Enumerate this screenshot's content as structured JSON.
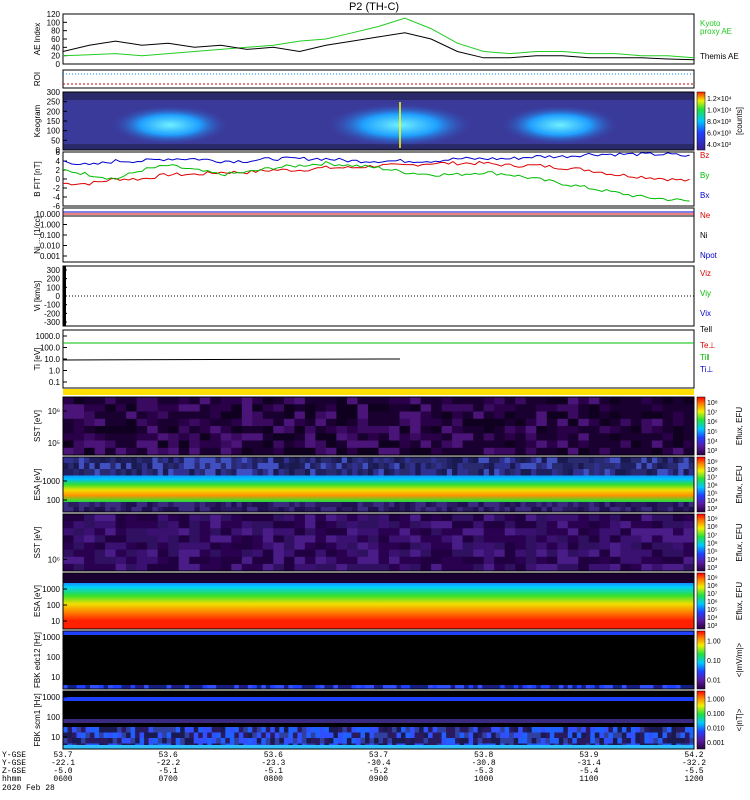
{
  "title": "P2 (TH-C)",
  "date_label": "2020 Feb 28",
  "footer": {
    "row_labels": [
      "Y-GSE",
      "Y-GSE",
      "Z-GSE",
      "hhmm"
    ],
    "columns": [
      {
        "v": [
          "53.7",
          "-22.1",
          "-5.0",
          "0600"
        ]
      },
      {
        "v": [
          "53.6",
          "-22.2",
          "-5.1",
          "0700"
        ]
      },
      {
        "v": [
          "53.6",
          "-23.3",
          "-5.1",
          "0800"
        ]
      },
      {
        "v": [
          "53.7",
          "-30.4",
          "-5.2",
          "0900"
        ]
      },
      {
        "v": [
          "53.8",
          "-30.8",
          "-5.3",
          "1000"
        ]
      },
      {
        "v": [
          "53.9",
          "-31.4",
          "-5.4",
          "1100"
        ]
      },
      {
        "v": [
          "54.2",
          "-32.2",
          "-5.5",
          "1200"
        ]
      }
    ]
  },
  "panels": {
    "ae": {
      "ylabel": "AE Index",
      "ticks": [
        "120",
        "100",
        "80",
        "60",
        "40",
        "20",
        "0"
      ],
      "legend": [
        {
          "text": "Kyoto",
          "color": "#22cc22"
        },
        {
          "text": "proxy AE",
          "color": "#22cc22"
        },
        {
          "text": "Themis AE",
          "color": "#000000"
        }
      ]
    },
    "roi": {
      "ylabel": "ROI"
    },
    "keogram": {
      "ylabel": "Keogram",
      "ticks": [
        "300",
        "250",
        "200",
        "150",
        "100",
        "50",
        "0"
      ],
      "colorbar_ticks": [
        "1.2×10⁴",
        "1.0×10⁴",
        "8.0×10³",
        "6.0×10³",
        "4.0×10³"
      ],
      "colorbar_label": "[counts]"
    },
    "bfit": {
      "ylabel": "B FIT [nT]",
      "ticks": [
        "6",
        "4",
        "2",
        "0",
        "-2",
        "-4",
        "-6"
      ],
      "legend": [
        {
          "text": "Bz",
          "color": "#dd0000"
        },
        {
          "text": "By",
          "color": "#00bb00"
        },
        {
          "text": "Bx",
          "color": "#0000cc"
        }
      ]
    },
    "dens": {
      "ylabel": "Ni ... [1/cc]",
      "ticks": [
        "10.000",
        "1.000",
        "0.100",
        "0.010",
        "0.001"
      ],
      "legend": [
        {
          "text": "Ne",
          "color": "#dd0000"
        },
        {
          "text": "Ni",
          "color": "#000000"
        },
        {
          "text": "Npot",
          "color": "#0000cc"
        }
      ]
    },
    "vel": {
      "ylabel": "Vi [km/s]",
      "ticks": [
        "300",
        "200",
        "100",
        "0",
        "-100",
        "-200",
        "-300"
      ],
      "legend": [
        {
          "text": "Viz",
          "color": "#dd0000"
        },
        {
          "text": "Viy",
          "color": "#00bb00"
        },
        {
          "text": "Vix",
          "color": "#0000cc"
        }
      ]
    },
    "temp": {
      "ylabel": "Ti [eV]",
      "ticks": [
        "1000.0",
        "100.0",
        "10.0",
        "1.0",
        "0.1"
      ],
      "legend": [
        {
          "text": "Tell",
          "color": "#000000"
        },
        {
          "text": "Te⊥",
          "color": "#dd0000"
        },
        {
          "text": "Ti‖",
          "color": "#00bb00"
        },
        {
          "text": "Ti⊥",
          "color": "#0000cc"
        }
      ]
    },
    "sst_e": {
      "ylabel": "SST [eV]",
      "ticks": [
        "10⁶",
        "10⁵"
      ],
      "colorbar_ticks": [
        "10⁸",
        "10⁷",
        "10⁶",
        "10⁵",
        "10⁴",
        "10³"
      ],
      "colorbar_label": "Eflux, EFU"
    },
    "esa_e": {
      "ylabel": "ESA [eV]",
      "ticks": [
        "1000",
        "100"
      ],
      "colorbar_ticks": [
        "10⁹",
        "10⁸",
        "10⁷",
        "10⁶",
        "10⁵",
        "10⁴",
        "10³"
      ],
      "colorbar_label": "Eflux, EFU"
    },
    "sst_i": {
      "ylabel": "SST [eV]",
      "ticks": [
        "10⁶"
      ],
      "colorbar_ticks": [
        "10⁹",
        "10⁸",
        "10⁷",
        "10⁶",
        "10⁵",
        "10⁴",
        "10³"
      ],
      "colorbar_label": "Eflux, EFU"
    },
    "esa_i": {
      "ylabel": "ESA [eV]",
      "ticks": [
        "1000",
        "100",
        "10"
      ],
      "colorbar_ticks": [
        "10⁹",
        "10⁸",
        "10⁷",
        "10⁶",
        "10⁵",
        "10⁴",
        "10³"
      ],
      "colorbar_label": "Eflux, EFU"
    },
    "fbk_e": {
      "ylabel": "FBK edc12 [Hz]",
      "ticks": [
        "1000",
        "100",
        "10"
      ],
      "colorbar_ticks": [
        "1.00",
        "0.10",
        "0.01"
      ],
      "colorbar_label": "<|mV/m|>"
    },
    "fbk_b": {
      "ylabel": "FBK scm1 [Hz]",
      "ticks": [
        "1000",
        "100",
        "10"
      ],
      "colorbar_ticks": [
        "1.000",
        "0.100",
        "0.010",
        "0.001"
      ],
      "colorbar_label": "<|nT|>"
    }
  },
  "chart_data": [
    {
      "type": "line",
      "title": "P2 (TH-C)",
      "ylabel": "AE Index",
      "ylim": [
        0,
        120
      ],
      "x": [
        6.0,
        6.25,
        6.5,
        6.75,
        7.0,
        7.25,
        7.5,
        7.75,
        8.0,
        8.25,
        8.5,
        8.75,
        9.0,
        9.25,
        9.5,
        9.75,
        10.0,
        10.25,
        10.5,
        10.75,
        11.0,
        11.25,
        11.5,
        11.75,
        12.0
      ],
      "series": [
        {
          "name": "Kyoto proxy AE",
          "color": "#22cc22",
          "values": [
            20,
            22,
            25,
            20,
            25,
            30,
            35,
            40,
            45,
            55,
            60,
            75,
            90,
            110,
            85,
            50,
            30,
            25,
            30,
            30,
            25,
            25,
            20,
            20,
            15
          ]
        },
        {
          "name": "Themis AE",
          "color": "#000000",
          "values": [
            30,
            45,
            55,
            45,
            50,
            40,
            45,
            35,
            40,
            30,
            45,
            55,
            65,
            75,
            60,
            30,
            15,
            15,
            20,
            20,
            15,
            15,
            15,
            12,
            10
          ]
        }
      ]
    },
    {
      "type": "heatmap",
      "ylabel": "Keogram",
      "ylim": [
        0,
        300
      ],
      "colorbar": [
        4000,
        12000
      ]
    },
    {
      "type": "line",
      "ylabel": "B FIT [nT]",
      "ylim": [
        -6,
        6
      ],
      "x": [
        6.0,
        6.25,
        6.5,
        6.75,
        7.0,
        7.25,
        7.5,
        7.75,
        8.0,
        8.25,
        8.5,
        8.75,
        9.0,
        9.25,
        9.5,
        9.75,
        10.0,
        10.25,
        10.5,
        10.75,
        11.0,
        11.25,
        11.5,
        11.75,
        12.0
      ],
      "series": [
        {
          "name": "Bz",
          "color": "#dd0000",
          "values": [
            -1,
            -1,
            0,
            0,
            1,
            1,
            1.5,
            1.5,
            2,
            2,
            2.5,
            2.5,
            3,
            3,
            3.5,
            3.5,
            3.5,
            3,
            3,
            2.5,
            2,
            1,
            0.5,
            0,
            -0.5
          ]
        },
        {
          "name": "By",
          "color": "#00bb00",
          "values": [
            2,
            1,
            0,
            2,
            3,
            2,
            1,
            1.5,
            2.5,
            3,
            3.5,
            3,
            2.5,
            1.5,
            1,
            1,
            1.5,
            1,
            0,
            -1,
            -2,
            -3,
            -4,
            -4.5,
            -5
          ]
        },
        {
          "name": "Bx",
          "color": "#0000cc",
          "values": [
            4,
            3,
            4,
            4,
            4.5,
            4.5,
            4,
            4,
            4.5,
            4.5,
            4.5,
            4,
            4,
            4,
            4,
            4.5,
            4.5,
            4.5,
            5,
            5,
            5.5,
            5.5,
            5.5,
            5.5,
            5
          ]
        }
      ]
    },
    {
      "type": "line",
      "ylabel": "Ni [1/cc]",
      "ylim": [
        0.001,
        10
      ],
      "scale": "log",
      "series": [
        {
          "name": "Ne",
          "color": "#dd0000",
          "values": [
            8,
            8,
            8,
            8
          ]
        },
        {
          "name": "Ni",
          "color": "#000000",
          "values": [
            6,
            6,
            6,
            6
          ]
        },
        {
          "name": "Npot",
          "color": "#0000cc",
          "values": [
            10,
            10,
            10,
            10
          ]
        }
      ]
    },
    {
      "type": "line",
      "ylabel": "Vi [km/s]",
      "ylim": [
        -300,
        300
      ],
      "series": [
        {
          "name": "Vix",
          "color": "#0000cc",
          "values": [
            0,
            0,
            0,
            0
          ]
        }
      ]
    },
    {
      "type": "line",
      "ylabel": "Ti [eV]",
      "ylim": [
        0.1,
        1000
      ],
      "scale": "log",
      "series": [
        {
          "name": "Ti‖",
          "color": "#00bb00",
          "values": [
            600,
            600,
            600,
            600
          ]
        },
        {
          "name": "Tell",
          "color": "#000000",
          "values": [
            30,
            30,
            30,
            30
          ]
        }
      ]
    },
    {
      "type": "heatmap",
      "ylabel": "SST [eV]",
      "colorbar": "Eflux, EFU"
    },
    {
      "type": "heatmap",
      "ylabel": "ESA [eV]",
      "colorbar": "Eflux, EFU"
    },
    {
      "type": "heatmap",
      "ylabel": "SST [eV]",
      "colorbar": "Eflux, EFU"
    },
    {
      "type": "heatmap",
      "ylabel": "ESA [eV]",
      "colorbar": "Eflux, EFU"
    },
    {
      "type": "heatmap",
      "ylabel": "FBK edc12 [Hz]",
      "colorbar": "<|mV/m|>"
    },
    {
      "type": "heatmap",
      "ylabel": "FBK scm1 [Hz]",
      "colorbar": "<|nT|>"
    }
  ]
}
